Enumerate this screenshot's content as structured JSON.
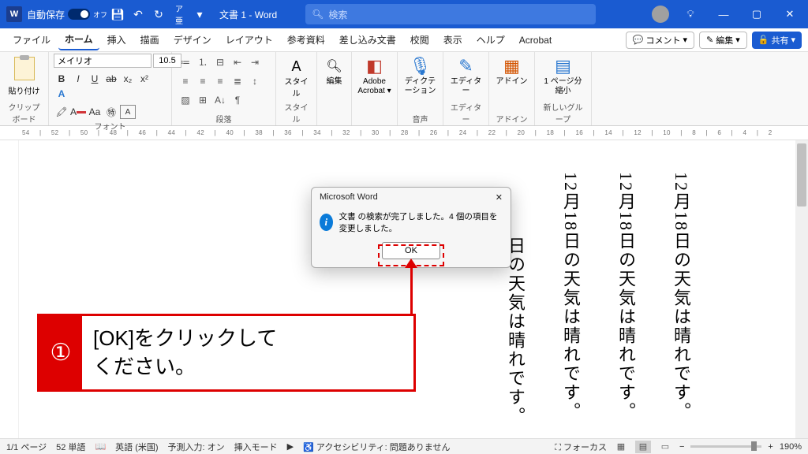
{
  "titlebar": {
    "autosave_label": "自動保存",
    "autosave_state": "オフ",
    "doc_title": "文書 1 - Word",
    "search_placeholder": "検索"
  },
  "tabs": {
    "file": "ファイル",
    "home": "ホーム",
    "insert": "挿入",
    "draw": "描画",
    "design": "デザイン",
    "layout": "レイアウト",
    "references": "参考資料",
    "mailings": "差し込み文書",
    "review": "校閲",
    "view": "表示",
    "help": "ヘルプ",
    "acrobat": "Acrobat",
    "comment": "コメント",
    "editing": "編集",
    "share": "共有"
  },
  "ribbon": {
    "clipboard_paste": "貼り付け",
    "clipboard_label": "クリップボード",
    "font_name": "メイリオ",
    "font_size": "10.5",
    "font_label": "フォント",
    "para_label": "段落",
    "style_btn": "スタイル",
    "style_label": "スタイル",
    "edit_btn": "編集",
    "adobe_btn": "Adobe\nAcrobat",
    "dictate_btn": "ディクテーション",
    "voice_label": "音声",
    "editor_btn": "エディター",
    "editor_label": "エディター",
    "addin_btn": "アドイン",
    "addin_label": "アドイン",
    "page_btn": "1 ページ分\n縮小",
    "newgroup_label": "新しいグループ"
  },
  "ruler": "54 | 52 | 50 | 48 | 46 | 44 | 42 | 40 | 38 | 36 | 34 | 32 | 30 | 28 | 26 | 24 | 22 | 20 | 18 | 16 | 14 | 12 | 10 | 8 | 6 | 4 | 2",
  "doc_text": {
    "col1": "12月18日の天気は晴れです。",
    "col2": "12月18日の天気は晴れです。",
    "col3": "12月18日の天気は晴れです。",
    "col4": "日の天気は晴れです。"
  },
  "dialog": {
    "title": "Microsoft Word",
    "message": "文書 の検索が完了しました。4 個の項目を変更しました。",
    "ok": "OK"
  },
  "callout": {
    "num": "①",
    "line1": "[OK]をクリックして",
    "line2": "ください。"
  },
  "status": {
    "page": "1/1 ページ",
    "words": "52 単語",
    "lang": "英語 (米国)",
    "predict": "予測入力: オン",
    "insert": "挿入モード",
    "a11y": "アクセシビリティ: 問題ありません",
    "focus": "フォーカス",
    "zoom": "190%"
  }
}
